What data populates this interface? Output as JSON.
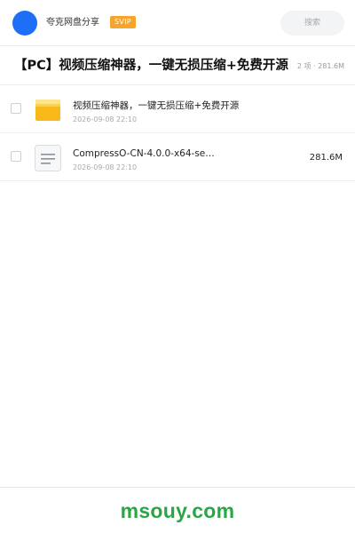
{
  "header": {
    "brand": "夸克网盘分享",
    "badge": "SVIP",
    "search_label": "搜索"
  },
  "title_row": {
    "title": "【PC】视频压缩神器，一键无损压缩+免费开源",
    "summary": "2 项 · 281.6M"
  },
  "files": [
    {
      "name": "视频压缩神器，一键无损压缩+免费开源",
      "date": "2026-09-08 22:10",
      "size": "",
      "icon": "folder-icon"
    },
    {
      "name": "CompressO-CN-4.0.0-x64-se…",
      "date": "2026-09-08 22:10",
      "size": "281.6M",
      "icon": "file-icon"
    }
  ],
  "footer": {
    "watermark": "msouy.com"
  },
  "colors": {
    "accent": "#1e6ff5",
    "badge": "#f5a52b",
    "folder": "#fbc02d",
    "watermark": "#28a745"
  }
}
